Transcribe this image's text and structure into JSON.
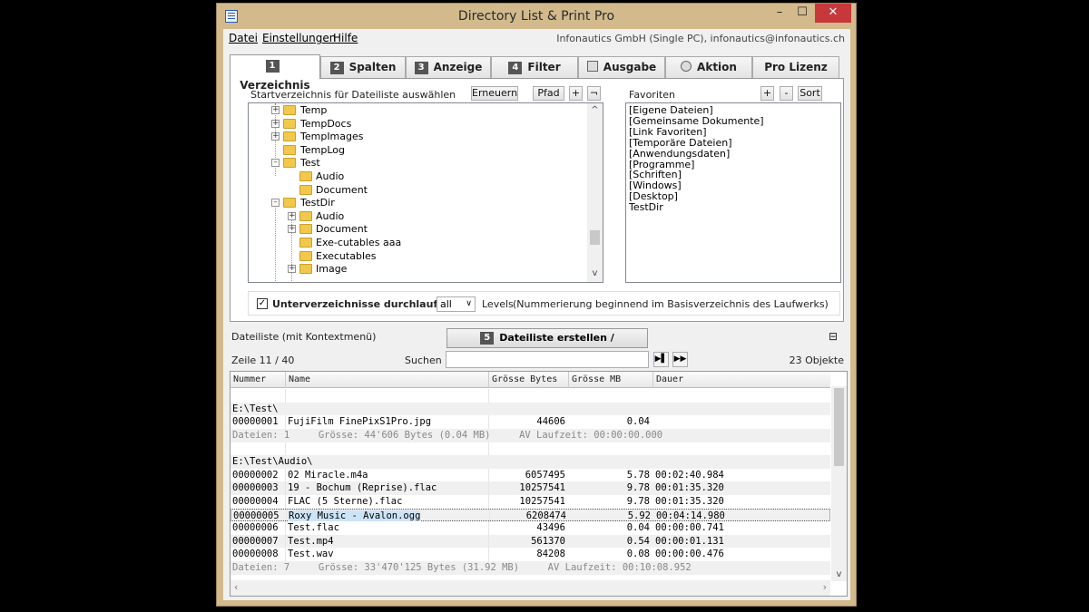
{
  "window": {
    "title": "Directory List & Print Pro",
    "min": "–",
    "max": "☐",
    "close": "✕"
  },
  "menu": {
    "items": [
      "Datei",
      "Einstellungen",
      "Hilfe"
    ],
    "company": "Infonautics GmbH (Single PC), infonautics@infonautics.ch"
  },
  "tabs": [
    {
      "num": "1",
      "label": "Verzeichnis"
    },
    {
      "num": "2",
      "label": "Spalten"
    },
    {
      "num": "3",
      "label": "Anzeige"
    },
    {
      "num": "4",
      "label": "Filter"
    },
    {
      "num": "",
      "label": "Ausgabe"
    },
    {
      "num": "",
      "label": "Aktion"
    },
    {
      "num": "",
      "label": "Pro Lizenz"
    }
  ],
  "dirpanel": {
    "label": "Startverzeichnis für Dateiliste auswählen",
    "btn_refresh": "Erneuern",
    "btn_path": "Pfad",
    "btn_add": "+",
    "btn_back": "¬",
    "tree": [
      {
        "label": "Temp",
        "toggle": "+"
      },
      {
        "label": "TempDocs",
        "toggle": "+"
      },
      {
        "label": "TempImages",
        "toggle": "+"
      },
      {
        "label": "TempLog",
        "toggle": ""
      },
      {
        "label": "Test",
        "toggle": "–"
      },
      {
        "label": "Audio",
        "toggle": ""
      },
      {
        "label": "Document",
        "toggle": ""
      },
      {
        "label": "TestDir",
        "toggle": "–"
      },
      {
        "label": "Audio",
        "toggle": "+"
      },
      {
        "label": "Document",
        "toggle": "+"
      },
      {
        "label": "Exe-cutables aaa",
        "toggle": ""
      },
      {
        "label": "Executables",
        "toggle": ""
      },
      {
        "label": "Image",
        "toggle": "+"
      }
    ],
    "scroll_up": "^",
    "scroll_down": "v"
  },
  "favorites": {
    "label": "Favoriten",
    "btn_add": "+",
    "btn_remove": "-",
    "btn_sort": "Sort",
    "items": [
      "[Eigene Dateien]",
      "[Gemeinsame Dokumente]",
      "[Link Favoriten]",
      "[Temporäre Dateien]",
      "[Anwendungsdaten]",
      "[Programme]",
      "[Schriften]",
      "[Windows]",
      "[Desktop]",
      "TestDir"
    ]
  },
  "options": {
    "checkbox_checked": true,
    "checkbox_label": "Unterverzeichnisse durchlaufen!",
    "levels_value": "all",
    "levels_label": "Levels",
    "levels_note": "(Nummerierung beginnend im Basisverzeichnis des Laufwerks)"
  },
  "filelist": {
    "label": "Dateiliste (mit Kontextmenü)",
    "create_num": "5",
    "create_label": "Dateiliste erstellen / aktualisieren !",
    "row_info": "Zeile 11 / 40",
    "search_label": "Suchen",
    "search_value": "",
    "next_btn": "▶▌",
    "last_btn": "▶▶",
    "count": "23 Objekte",
    "columns": [
      "Nummer",
      "Name",
      "Grösse Bytes",
      "Grösse MB",
      "Dauer"
    ],
    "rows": [
      {
        "type": "blank",
        "cells": [
          "",
          "",
          "",
          "",
          ""
        ]
      },
      {
        "type": "dir",
        "text": "E:\\Test\\"
      },
      {
        "type": "file",
        "cells": [
          "00000001",
          "FujiFilm FinePixS1Pro.jpg",
          "44606",
          "0.04",
          ""
        ]
      },
      {
        "type": "sum",
        "text": "Dateien: 1     Grösse: 44'606 Bytes (0.04 MB)     AV Laufzeit: 00:00:00.000"
      },
      {
        "type": "blank",
        "cells": [
          "",
          "",
          "",
          "",
          ""
        ]
      },
      {
        "type": "dir",
        "text": "E:\\Test\\Audio\\"
      },
      {
        "type": "file",
        "cells": [
          "00000002",
          "02 Miracle.m4a",
          "6057495",
          "5.78",
          "00:02:40.984"
        ]
      },
      {
        "type": "file",
        "cells": [
          "00000003",
          "19 - Bochum (Reprise).flac",
          "10257541",
          "9.78",
          "00:01:35.320"
        ]
      },
      {
        "type": "file",
        "cells": [
          "00000004",
          "FLAC (5 Sterne).flac",
          "10257541",
          "9.78",
          "00:01:35.320"
        ]
      },
      {
        "type": "file",
        "selected": true,
        "cells": [
          "00000005",
          "Roxy Music - Avalon.ogg",
          "6208474",
          "5.92",
          "00:04:14.980"
        ]
      },
      {
        "type": "file",
        "cells": [
          "00000006",
          "Test.flac",
          "43496",
          "0.04",
          "00:00:00.741"
        ]
      },
      {
        "type": "file",
        "cells": [
          "00000007",
          "Test.mp4",
          "561370",
          "0.54",
          "00:00:01.131"
        ]
      },
      {
        "type": "file",
        "cells": [
          "00000008",
          "Test.wav",
          "84208",
          "0.08",
          "00:00:00.476"
        ]
      },
      {
        "type": "sum",
        "text": "Dateien: 7     Grösse: 33'470'125 Bytes (31.92 MB)     AV Laufzeit: 00:10:08.952"
      }
    ]
  }
}
